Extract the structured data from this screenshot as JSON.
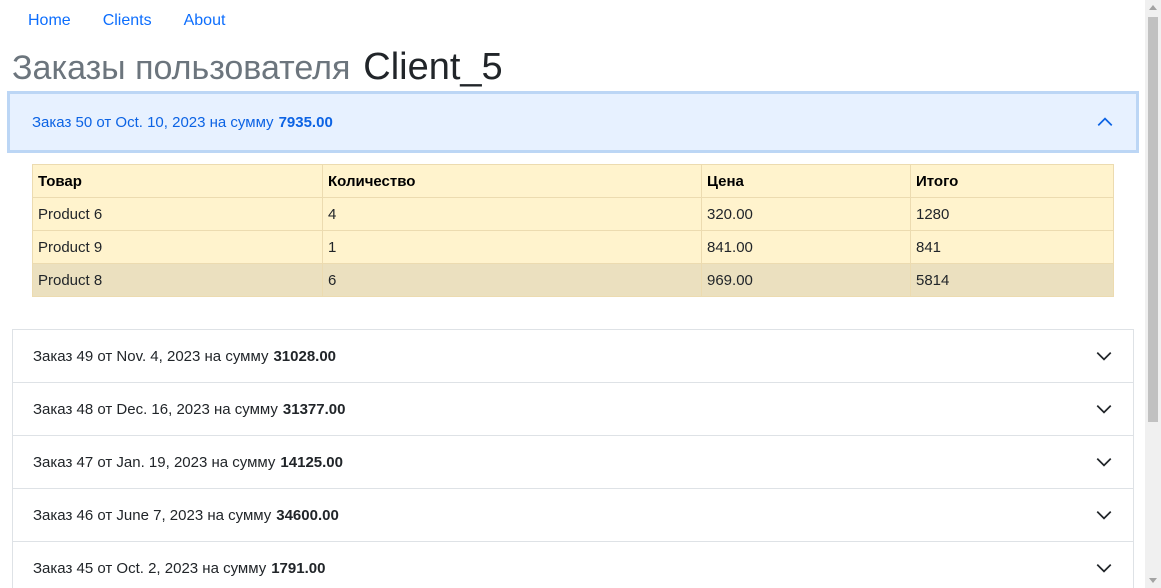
{
  "nav": [
    {
      "label": "Home"
    },
    {
      "label": "Clients"
    },
    {
      "label": "About"
    }
  ],
  "page": {
    "title_prefix": "Заказы пользователя",
    "title_name": "Client_5"
  },
  "orders": [
    {
      "text": "Заказ 50 от Oct. 10, 2023 на сумму",
      "total": "7935.00",
      "open": true,
      "table": {
        "headers": [
          "Товар",
          "Количество",
          "Цена",
          "Итого"
        ],
        "rows": [
          [
            "Product 6",
            "4",
            "320.00",
            "1280"
          ],
          [
            "Product 9",
            "1",
            "841.00",
            "841"
          ],
          [
            "Product 8",
            "6",
            "969.00",
            "5814"
          ]
        ]
      }
    },
    {
      "text": "Заказ 49 от Nov. 4, 2023 на сумму",
      "total": "31028.00",
      "open": false
    },
    {
      "text": "Заказ 48 от Dec. 16, 2023 на сумму",
      "total": "31377.00",
      "open": false
    },
    {
      "text": "Заказ 47 от Jan. 19, 2023 на сумму",
      "total": "14125.00",
      "open": false
    },
    {
      "text": "Заказ 46 от June 7, 2023 на сумму",
      "total": "34600.00",
      "open": false
    },
    {
      "text": "Заказ 45 от Oct. 2, 2023 на сумму",
      "total": "1791.00",
      "open": false
    }
  ],
  "icons": {
    "collapse": "chevron-up-icon",
    "expand": "chevron-down-icon"
  },
  "colors": {
    "link": "#0d6efd",
    "accordion_active_bg": "#e7f1ff",
    "accordion_active_text": "#0c63e4",
    "table_warning_bg": "#fff3cd",
    "table_row_hover_bg": "#ebe0bf"
  }
}
